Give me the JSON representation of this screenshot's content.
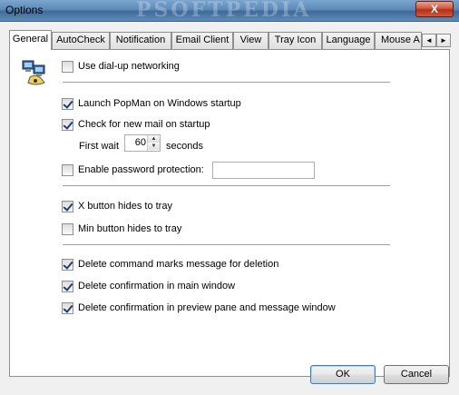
{
  "window": {
    "title": "Options",
    "watermark": "PSOFTPEDIA",
    "close_glyph": "X"
  },
  "tabs": [
    {
      "label": "General",
      "active": true
    },
    {
      "label": "AutoCheck"
    },
    {
      "label": "Notification"
    },
    {
      "label": "Email Client"
    },
    {
      "label": "View"
    },
    {
      "label": "Tray Icon"
    },
    {
      "label": "Language"
    },
    {
      "label": "Mouse A"
    }
  ],
  "tab_scroll": {
    "left": "◄",
    "right": "►"
  },
  "general": {
    "dialup": {
      "label": "Use dial-up networking",
      "checked": false
    },
    "launch_startup": {
      "label": "Launch PopMan on Windows startup",
      "checked": true
    },
    "check_mail_startup": {
      "label": "Check for new mail on startup",
      "checked": true
    },
    "first_wait": {
      "label": "First wait",
      "value": "60",
      "unit": "seconds"
    },
    "password_protection": {
      "label": "Enable password protection:",
      "checked": false,
      "value": ""
    },
    "x_hides_tray": {
      "label": "X button hides to tray",
      "checked": true
    },
    "min_hides_tray": {
      "label": "Min button hides to tray",
      "checked": false
    },
    "delete_marks": {
      "label": "Delete command marks message for deletion",
      "checked": true
    },
    "delete_confirm_main": {
      "label": "Delete confirmation in main window",
      "checked": true
    },
    "delete_confirm_preview": {
      "label": "Delete confirmation in preview pane and message window",
      "checked": true
    }
  },
  "buttons": {
    "ok": "OK",
    "cancel": "Cancel"
  },
  "icons": {
    "network": "network-computers-icon"
  }
}
